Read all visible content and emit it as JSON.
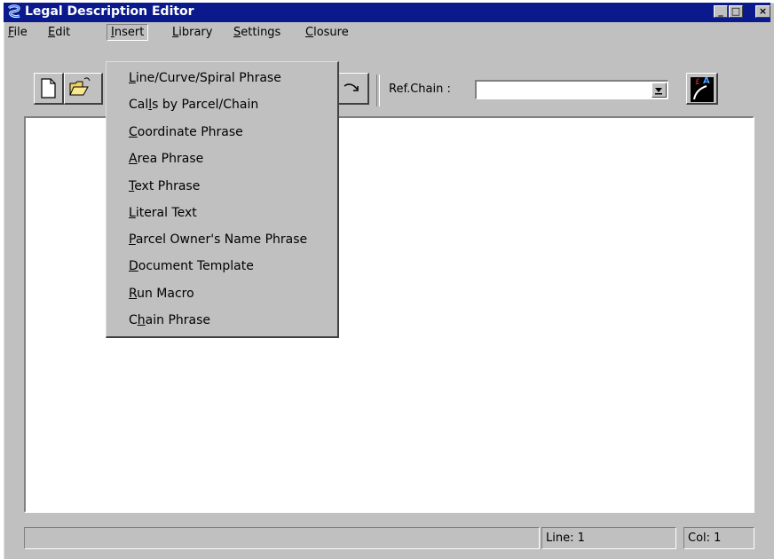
{
  "window": {
    "title": "Legal Description Editor",
    "min": "_",
    "max": "□",
    "close": "×"
  },
  "menubar": {
    "file": {
      "pre": "",
      "acc": "F",
      "post": "ile"
    },
    "edit": {
      "pre": "",
      "acc": "E",
      "post": "dit"
    },
    "insert": {
      "pre": "",
      "acc": "I",
      "post": "nsert"
    },
    "library": {
      "pre": "",
      "acc": "L",
      "post": "ibrary"
    },
    "settings": {
      "pre": "",
      "acc": "S",
      "post": "ettings"
    },
    "closure": {
      "pre": "",
      "acc": "C",
      "post": "losure"
    }
  },
  "toolbar": {
    "ref_chain_label": "Ref.Chain :",
    "ref_chain_value": ""
  },
  "insert_menu": {
    "items": [
      {
        "pre": "",
        "acc": "L",
        "post": "ine/Curve/Spiral Phrase"
      },
      {
        "pre": "Cal",
        "acc": "l",
        "post": "s by Parcel/Chain"
      },
      {
        "pre": "",
        "acc": "C",
        "post": "oordinate Phrase"
      },
      {
        "pre": "",
        "acc": "A",
        "post": "rea Phrase"
      },
      {
        "pre": "",
        "acc": "T",
        "post": "ext Phrase"
      },
      {
        "pre": "",
        "acc": "L",
        "post": "iteral Text"
      },
      {
        "pre": "",
        "acc": "P",
        "post": "arcel Owner's Name Phrase"
      },
      {
        "pre": "",
        "acc": "D",
        "post": "ocument Template"
      },
      {
        "pre": "",
        "acc": "R",
        "post": "un Macro"
      },
      {
        "pre": "C",
        "acc": "h",
        "post": "ain Phrase"
      }
    ]
  },
  "statusbar": {
    "message": "",
    "line": "Line: 1",
    "col": "Col: 1"
  },
  "colors": {
    "titlebar": "#0a1a8c",
    "face": "#c0c0c0"
  }
}
